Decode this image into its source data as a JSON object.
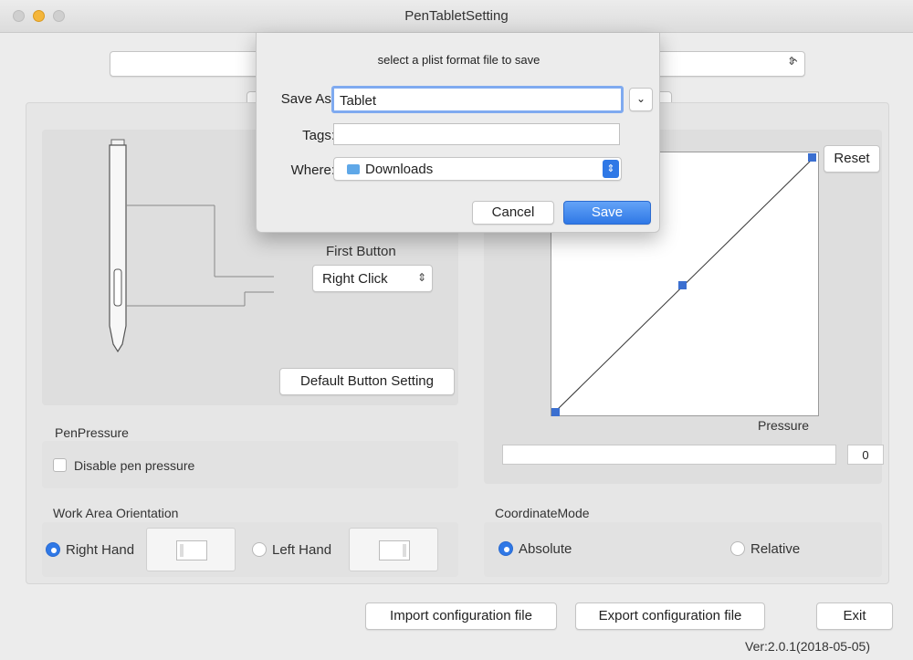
{
  "window": {
    "title": "PenTabletSetting"
  },
  "pen_panel": {
    "first_button_label": "First Button",
    "first_button_value": "Right Click",
    "default_button": "Default  Button Setting"
  },
  "pressure_panel": {
    "reset": "Reset",
    "pressure_label": "Pressure",
    "pressure_value": "0"
  },
  "pen_pressure": {
    "heading": "PenPressure",
    "disable_label": "Disable pen pressure"
  },
  "orientation": {
    "heading": "Work Area Orientation",
    "right_hand": "Right Hand",
    "left_hand": "Left Hand"
  },
  "coordinate": {
    "heading": "CoordinateMode",
    "absolute": "Absolute",
    "relative": "Relative"
  },
  "footer": {
    "import": "Import configuration file",
    "export": "Export configuration file",
    "exit": "Exit",
    "version": "Ver:2.0.1(2018-05-05)"
  },
  "dialog": {
    "prompt": "select a plist format file to save",
    "save_as_label": "Save As:",
    "save_as_value": "Tablet",
    "tags_label": "Tags:",
    "tags_value": "",
    "where_label": "Where:",
    "where_value": "Downloads",
    "cancel": "Cancel",
    "save": "Save"
  },
  "colors": {
    "accent": "#2f78e6",
    "curve_handle": "#3b6fd0"
  }
}
